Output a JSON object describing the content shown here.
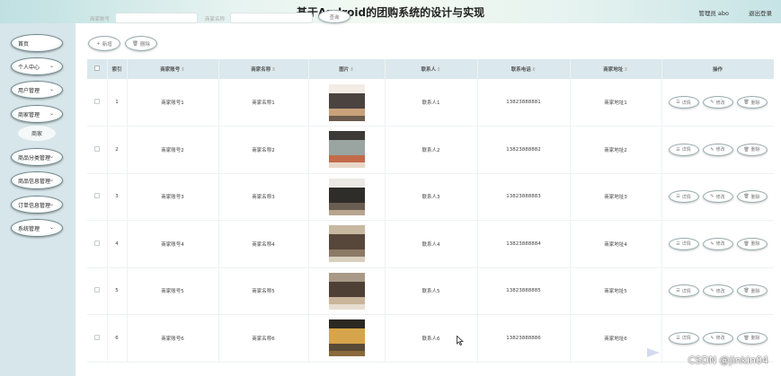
{
  "header": {
    "title": "基于Android的团购系统的设计与实现",
    "user": "管理员 abo",
    "logout": "退出登录"
  },
  "sidebar": {
    "items": [
      {
        "label": "首页",
        "chevron": false
      },
      {
        "label": "个人中心",
        "chevron": true
      },
      {
        "label": "用户管理",
        "chevron": true
      },
      {
        "label": "商家管理",
        "chevron": true
      },
      {
        "label": "商品分类管理",
        "chevron": true
      },
      {
        "label": "商品信息管理",
        "chevron": true
      },
      {
        "label": "订单信息管理",
        "chevron": true
      },
      {
        "label": "系统管理",
        "chevron": true
      }
    ],
    "submenu": {
      "label": "商家"
    }
  },
  "toolbar": {
    "search_label_1": "商家账号",
    "search_label_2": "商家名称",
    "search_button": "查询",
    "add_label": "新增",
    "delete_label": "删除"
  },
  "table": {
    "columns": [
      "索引",
      "商家账号",
      "商家名称",
      "图片",
      "联系人",
      "联系电话",
      "商家地址",
      "操作"
    ],
    "rows": [
      {
        "index": "1",
        "account": "商家账号1",
        "name": "商家名称1",
        "contact": "联系人1",
        "phone": "13823888881",
        "address": "商家地址1"
      },
      {
        "index": "2",
        "account": "商家账号2",
        "name": "商家名称2",
        "contact": "联系人2",
        "phone": "13823888882",
        "address": "商家地址2"
      },
      {
        "index": "3",
        "account": "商家账号3",
        "name": "商家名称3",
        "contact": "联系人3",
        "phone": "13823888883",
        "address": "商家地址3"
      },
      {
        "index": "4",
        "account": "商家账号4",
        "name": "商家名称4",
        "contact": "联系人4",
        "phone": "13823888884",
        "address": "商家地址4"
      },
      {
        "index": "5",
        "account": "商家账号5",
        "name": "商家名称5",
        "contact": "联系人5",
        "phone": "13823888885",
        "address": "商家地址5"
      },
      {
        "index": "6",
        "account": "商家账号6",
        "name": "商家名称6",
        "contact": "联系人6",
        "phone": "13823888886",
        "address": "商家地址6"
      }
    ],
    "actions": {
      "detail": "详情",
      "edit": "修改",
      "delete": "删除"
    }
  },
  "watermark": "CSDN @jinkin04",
  "colors": {
    "header_bg": "#e6f3f0",
    "sidebar_bg": "#d7e6ea",
    "table_header_bg": "#dbe8ed",
    "nav_border": "#6f8589"
  },
  "icons": [
    "plus-icon",
    "trash-icon",
    "list-icon",
    "pencil-icon",
    "chevron-down-icon",
    "sort-icon",
    "pointer-cursor-icon"
  ]
}
